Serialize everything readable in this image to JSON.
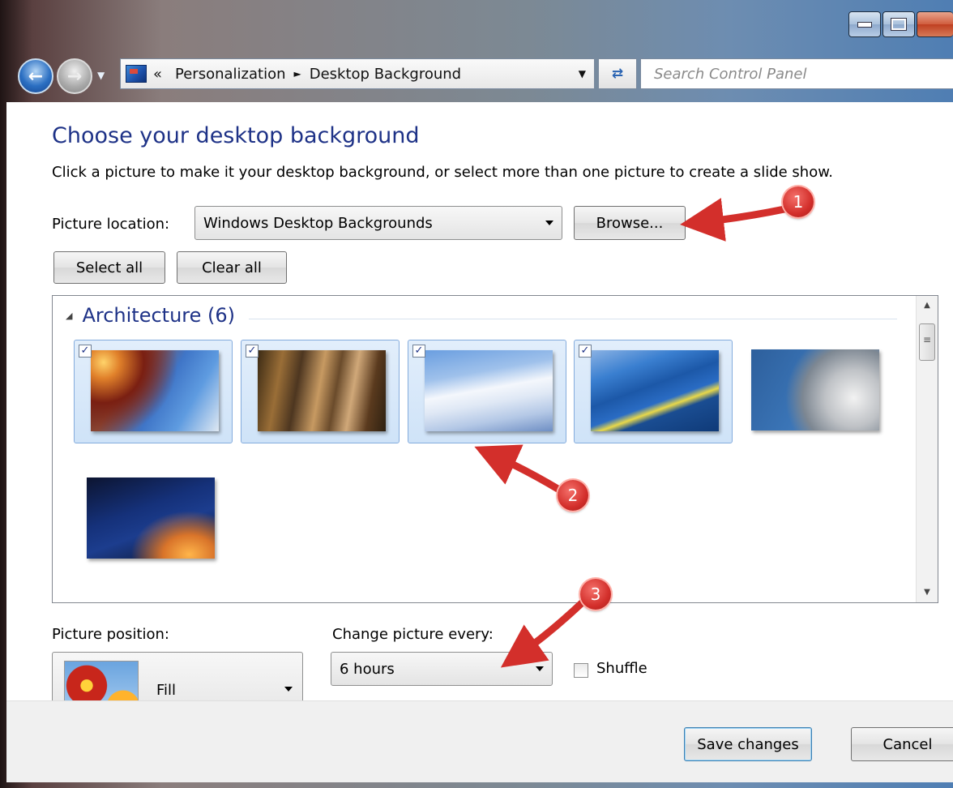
{
  "window": {
    "caption_buttons": [
      "minimize",
      "maximize",
      "close"
    ]
  },
  "nav": {
    "back_icon": "back-arrow-icon",
    "forward_icon": "forward-arrow-icon",
    "overflow": "«",
    "breadcrumb": [
      "Personalization",
      "Desktop Background"
    ],
    "search_placeholder": "Search Control Panel"
  },
  "page": {
    "title": "Choose your desktop background",
    "subtitle": "Click a picture to make it your desktop background, or select more than one picture to create a slide show."
  },
  "location": {
    "label": "Picture location:",
    "value": "Windows Desktop Backgrounds",
    "browse_label": "Browse..."
  },
  "selection": {
    "select_all_label": "Select all",
    "clear_all_label": "Clear all"
  },
  "gallery": {
    "group_title": "Architecture (6)",
    "items": [
      {
        "name": "architecture-1",
        "selected": true
      },
      {
        "name": "architecture-2",
        "selected": true
      },
      {
        "name": "architecture-3",
        "selected": true
      },
      {
        "name": "architecture-4",
        "selected": true
      },
      {
        "name": "architecture-5",
        "selected": false
      },
      {
        "name": "architecture-6",
        "selected": false
      }
    ]
  },
  "position": {
    "label": "Picture position:",
    "value": "Fill"
  },
  "interval": {
    "label": "Change picture every:",
    "value": "6 hours",
    "shuffle_label": "Shuffle",
    "shuffle_checked": false
  },
  "footer": {
    "save_label": "Save changes",
    "cancel_label": "Cancel"
  },
  "callouts": [
    "1",
    "2",
    "3"
  ],
  "colors": {
    "heading": "#1e3287",
    "callout": "#d32f2b",
    "selection": "#cfe3f8"
  }
}
